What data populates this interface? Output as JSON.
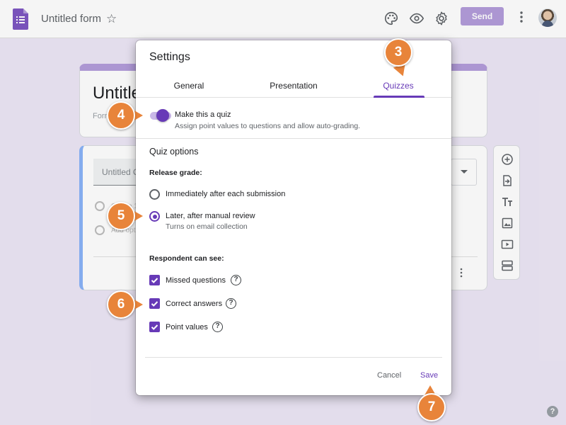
{
  "topbar": {
    "form_title": "Untitled form",
    "send_label": "Send",
    "icons": [
      "form-doc-icon",
      "star-icon",
      "palette-icon",
      "eye-icon",
      "gear-icon",
      "more-vert-icon",
      "avatar"
    ]
  },
  "background_form": {
    "title": "Untitle",
    "description": "Form",
    "question_title": "Untitled Q",
    "option_1": "Option 1",
    "add_option": "Add opti"
  },
  "side_toolbar": {
    "icons": [
      "add-circle-icon",
      "import-icon",
      "title-icon",
      "image-icon",
      "video-icon",
      "section-icon"
    ]
  },
  "dialog": {
    "title": "Settings",
    "tabs": [
      {
        "label": "General"
      },
      {
        "label": "Presentation"
      },
      {
        "label": "Quizzes",
        "active": true
      }
    ],
    "quiz_toggle": {
      "label": "Make this a quiz",
      "description": "Assign point values to questions and allow auto-grading.",
      "on": true
    },
    "quiz_options_title": "Quiz options",
    "release_grade": {
      "label": "Release grade:",
      "options": [
        {
          "label": "Immediately after each submission",
          "selected": false
        },
        {
          "label": "Later, after manual review",
          "sublabel": "Turns on email collection",
          "selected": true
        }
      ]
    },
    "respondent_can_see": {
      "label": "Respondent can see:",
      "items": [
        {
          "label": "Missed questions",
          "checked": true
        },
        {
          "label": "Correct answers",
          "checked": true
        },
        {
          "label": "Point values",
          "checked": true
        }
      ]
    },
    "cancel_label": "Cancel",
    "save_label": "Save"
  },
  "callouts": [
    "3",
    "4",
    "5",
    "6",
    "7"
  ],
  "colors": {
    "accent": "#673ab7",
    "send_button": "#b39ddb",
    "callout": "#e8843a",
    "background": "#ede7f6"
  }
}
